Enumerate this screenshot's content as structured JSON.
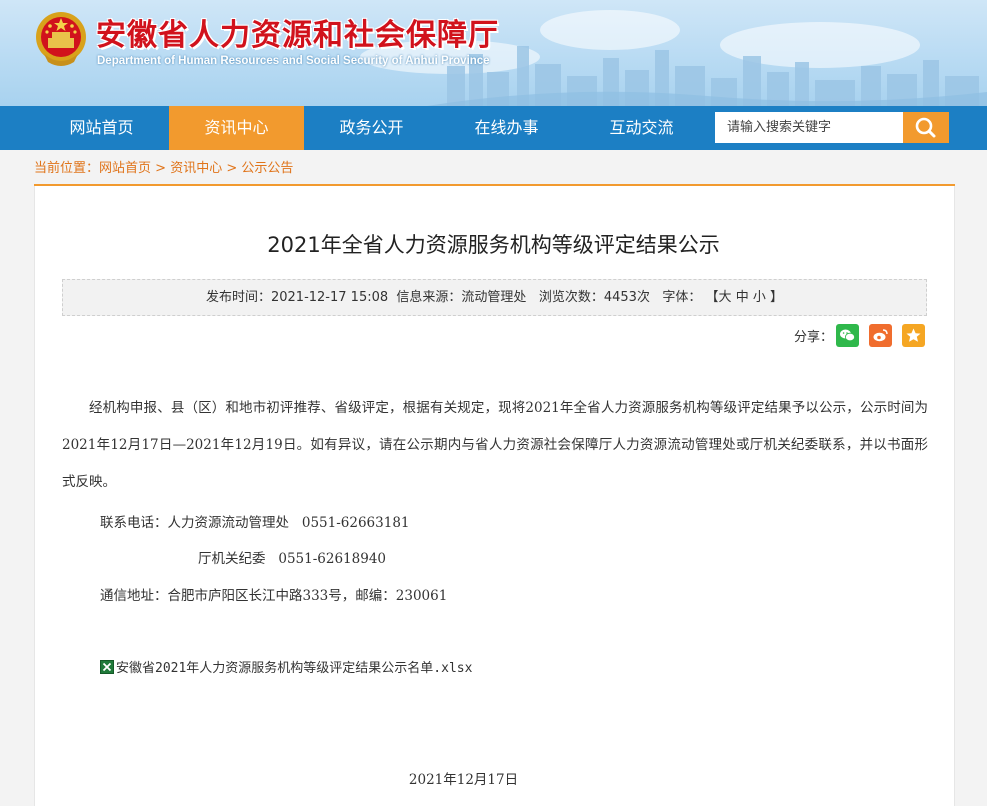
{
  "header": {
    "title": "安徽省人力资源和社会保障厅",
    "subtitle": "Department of Human Resources and Social Security of Anhui Province"
  },
  "nav": {
    "items": [
      {
        "label": "网站首页"
      },
      {
        "label": "资讯中心"
      },
      {
        "label": "政务公开"
      },
      {
        "label": "在线办事"
      },
      {
        "label": "互动交流"
      }
    ],
    "active_index": 1,
    "search": {
      "placeholder": "请输入搜索关键字"
    }
  },
  "breadcrumb": {
    "prefix": "当前位置：",
    "items": [
      "网站首页",
      "资讯中心",
      "公示公告"
    ],
    "separator": " > "
  },
  "article": {
    "title": "2021年全省人力资源服务机构等级评定结果公示",
    "meta": {
      "publish_label": "发布时间：",
      "publish_time": "2021-12-17 15:08",
      "source_label": "信息来源：",
      "source": "流动管理处",
      "views_label": "浏览次数：",
      "views": "4453次",
      "font_label": "字体：",
      "font_open": "【",
      "font_large": "大",
      "font_medium": "中",
      "font_small": "小",
      "font_close": "】"
    },
    "share_label": "分享：",
    "paragraph": "经机构申报、县（区）和地市初评推荐、省级评定，根据有关规定，现将2021年全省人力资源服务机构等级评定结果予以公示，公示时间为2021年12月17日—2021年12月19日。如有异议，请在公示期内与省人力资源社会保障厅人力资源流动管理处或厅机关纪委联系，并以书面形式反映。",
    "contact_line_1": "联系电话：人力资源流动管理处   0551-62663181",
    "contact_line_2": "厅机关纪委   0551-62618940",
    "address_line": "通信地址：合肥市庐阳区长江中路333号，邮编：230061",
    "attachment": "安徽省2021年人力资源服务机构等级评定结果公示名单.xlsx",
    "date": "2021年12月17日"
  },
  "colors": {
    "nav_bg": "#1c7fc4",
    "accent": "#f29a2e",
    "title_red": "#d1121c",
    "wechat": "#2fb84b",
    "weibo": "#f06d2e",
    "favorite": "#f5a623"
  }
}
